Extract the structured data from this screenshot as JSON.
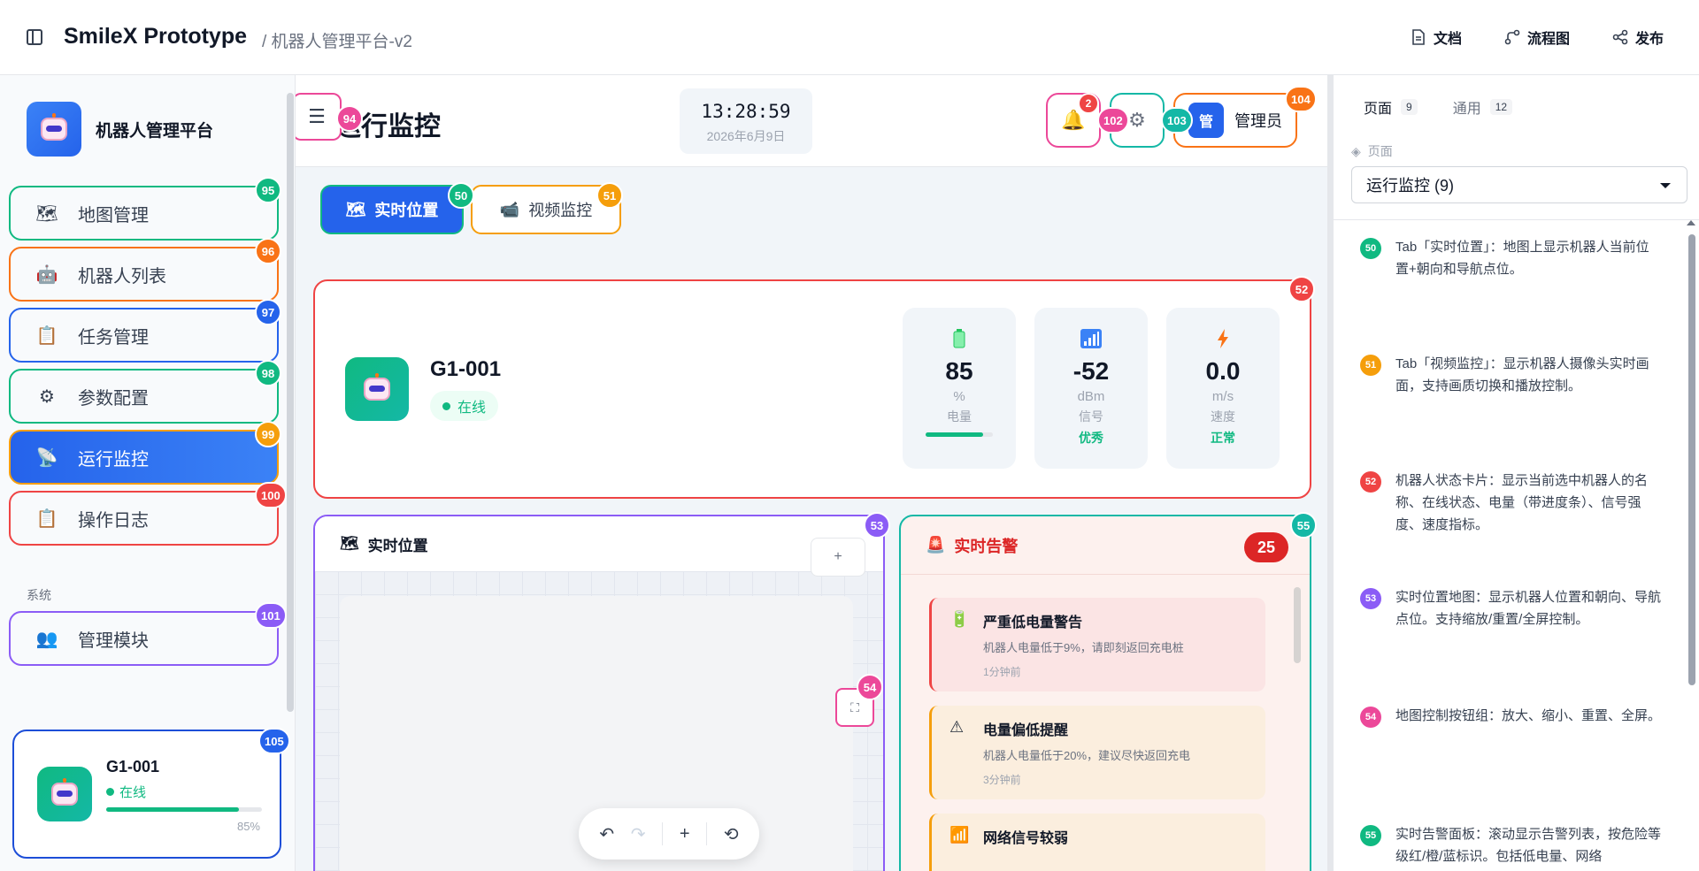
{
  "topbar": {
    "app_title": "SmileX Prototype",
    "breadcrumb": "/ 机器人管理平台-v2",
    "actions": [
      {
        "label": "文档",
        "icon": "document-icon"
      },
      {
        "label": "流程图",
        "icon": "flow-icon"
      },
      {
        "label": "发布",
        "icon": "share-icon"
      }
    ]
  },
  "sidebar": {
    "brand": "机器人管理平台",
    "items": [
      {
        "label": "地图管理",
        "icon": "map-icon",
        "badge": "95",
        "color": "#10b981"
      },
      {
        "label": "机器人列表",
        "icon": "robot-icon",
        "badge": "96",
        "color": "#f97316"
      },
      {
        "label": "任务管理",
        "icon": "clipboard-icon",
        "badge": "97",
        "color": "#2563eb"
      },
      {
        "label": "参数配置",
        "icon": "gear-icon",
        "badge": "98",
        "color": "#10b981"
      },
      {
        "label": "运行监控",
        "icon": "satellite-icon",
        "badge": "99",
        "color": "#f59e0b",
        "active": true
      },
      {
        "label": "操作日志",
        "icon": "clipboard-icon",
        "badge": "100",
        "color": "#ef4444"
      }
    ],
    "section_label": "系统",
    "system_item": {
      "label": "管理模块",
      "icon": "users-icon",
      "badge": "101",
      "color": "#8b5cf6"
    },
    "robot_card": {
      "name": "G1-001",
      "status": "在线",
      "battery": 85,
      "battery_text": "85%",
      "badge": "105"
    }
  },
  "header": {
    "menu_badge": "94",
    "title": "运行监控",
    "time": "13:28:59",
    "date": "2026年6月9日",
    "notif_count": "2",
    "notif_badge": "102",
    "settings_badge": "103",
    "admin_avatar": "管",
    "admin_label": "管理员",
    "admin_badge": "104"
  },
  "tabs": [
    {
      "label": "实时位置",
      "icon": "map-icon",
      "badge": "50"
    },
    {
      "label": "视频监控",
      "icon": "camera-icon",
      "badge": "51"
    }
  ],
  "status_card": {
    "badge": "52",
    "name": "G1-001",
    "status": "在线",
    "metrics": [
      {
        "icon": "battery-icon",
        "value": "85",
        "unit": "%",
        "label": "电量",
        "progress": 0.85
      },
      {
        "icon": "signal-icon",
        "value": "-52",
        "unit": "dBm",
        "label": "信号",
        "status": "优秀"
      },
      {
        "icon": "bolt-icon",
        "value": "0.0",
        "unit": "m/s",
        "label": "速度",
        "status": "正常"
      }
    ]
  },
  "map_panel": {
    "title": "实时位置",
    "badge": "53",
    "zoom_in": "+",
    "ctrl_badge": "54"
  },
  "alert_panel": {
    "title": "实时告警",
    "count": "25",
    "badge": "55",
    "alerts": [
      {
        "icon": "battery-icon",
        "title": "严重低电量警告",
        "desc": "机器人电量低于9%，请即刻返回充电桩",
        "time": "1分钟前",
        "level": "red"
      },
      {
        "icon": "warning-icon",
        "title": "电量偏低提醒",
        "desc": "机器人电量低于20%，建议尽快返回充电",
        "time": "3分钟前",
        "level": "orange"
      },
      {
        "icon": "signal-icon",
        "title": "网络信号较弱",
        "desc": "",
        "time": "",
        "level": "blue"
      }
    ]
  },
  "right_panel": {
    "tabs": [
      {
        "label": "页面",
        "count": "9"
      },
      {
        "label": "通用",
        "count": "12"
      }
    ],
    "section_label": "页面",
    "selected_page": "运行监控 (9)",
    "annotations": [
      {
        "num": "50",
        "color": "#10b981",
        "text": "Tab「实时位置」：地图上显示机器人当前位置+朝向和导航点位。"
      },
      {
        "num": "51",
        "color": "#f59e0b",
        "text": "Tab「视频监控」：显示机器人摄像头实时画面，支持画质切换和播放控制。"
      },
      {
        "num": "52",
        "color": "#ef4444",
        "text": "机器人状态卡片：显示当前选中机器人的名称、在线状态、电量（带进度条）、信号强度、速度指标。"
      },
      {
        "num": "53",
        "color": "#8b5cf6",
        "text": "实时位置地图：显示机器人位置和朝向、导航点位。支持缩放/重置/全屏控制。"
      },
      {
        "num": "54",
        "color": "#ec4899",
        "text": "地图控制按钮组：放大、缩小、重置、全屏。"
      },
      {
        "num": "55",
        "color": "#10b981",
        "text": "实时告警面板：滚动显示告警列表，按危险等级红/橙/蓝标识。包括低电量、网络"
      }
    ]
  }
}
